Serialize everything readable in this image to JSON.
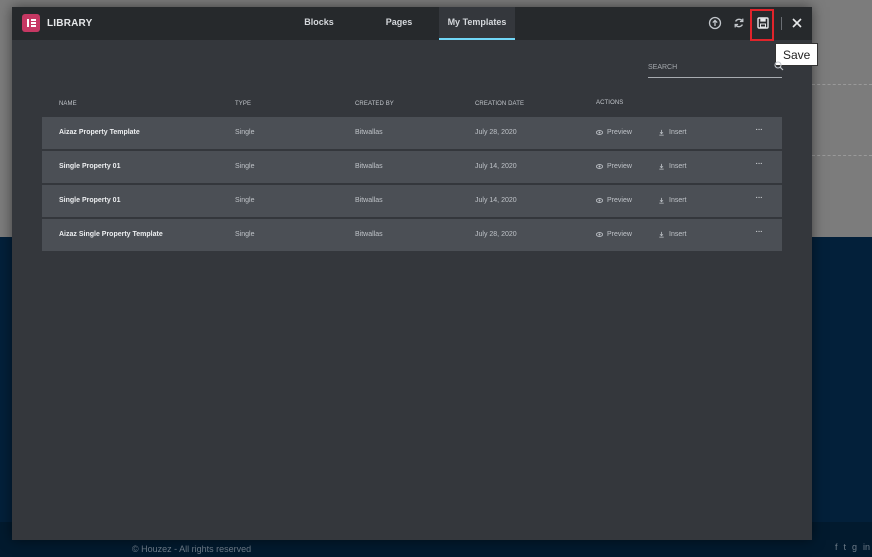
{
  "background": {
    "footer_text": "© Houzez - All rights reserved",
    "social_icons": [
      "facebook-icon",
      "twitter-icon",
      "google-plus-icon",
      "linkedin-icon"
    ]
  },
  "header": {
    "title": "LIBRARY",
    "logo_icon": "elementor-logo-icon",
    "tabs": [
      {
        "label": "Blocks",
        "active": false
      },
      {
        "label": "Pages",
        "active": false
      },
      {
        "label": "My Templates",
        "active": true
      }
    ],
    "icons": [
      "upload-icon",
      "sync-icon",
      "save-icon",
      "close-icon"
    ],
    "save_tooltip": "Save"
  },
  "search": {
    "placeholder": "SEARCH",
    "value": ""
  },
  "table": {
    "columns": [
      "NAME",
      "TYPE",
      "CREATED BY",
      "CREATION DATE",
      "ACTIONS"
    ],
    "rows": [
      {
        "name": "Aizaz Property Template",
        "type": "Single",
        "author": "Bitwallas",
        "date": "July 28, 2020",
        "preview": "Preview",
        "insert": "Insert"
      },
      {
        "name": "Single Property 01",
        "type": "Single",
        "author": "Bitwallas",
        "date": "July 14, 2020",
        "preview": "Preview",
        "insert": "Insert"
      },
      {
        "name": "Single Property 01",
        "type": "Single",
        "author": "Bitwallas",
        "date": "July 14, 2020",
        "preview": "Preview",
        "insert": "Insert"
      },
      {
        "name": "Aizaz Single Property Template",
        "type": "Single",
        "author": "Bitwallas",
        "date": "July 28, 2020",
        "preview": "Preview",
        "insert": "Insert"
      }
    ]
  },
  "colors": {
    "accent": "#71d7f7",
    "logo": "#c63863",
    "highlight": "#e0242b"
  }
}
